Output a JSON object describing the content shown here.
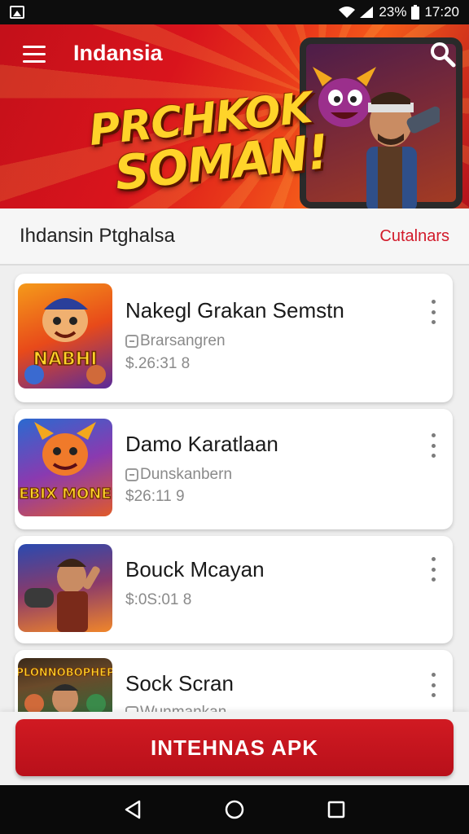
{
  "status_bar": {
    "battery_percent": "23%",
    "time": "17:20"
  },
  "header": {
    "title": "Indansia"
  },
  "banner": {
    "promo_line1": "PRCHKOK",
    "promo_line2": "SOMAN!"
  },
  "section": {
    "title": "Ihdansin Ptghalsa",
    "link": "Cutalnars"
  },
  "apps": [
    {
      "name": "Nakegl Grakan Semstn",
      "developer": "Brarsangren",
      "price": "$.26:31 8",
      "thumb_text": "NABHI"
    },
    {
      "name": "Damo Karatlaan",
      "developer": "Dunskanbern",
      "price": "$26:11 9",
      "thumb_text": "NEBIX MONEN"
    },
    {
      "name": "Bouck Mcayan",
      "developer": "",
      "price": "$:0S:01 8",
      "thumb_text": ""
    },
    {
      "name": "Sock Scran",
      "developer": "Wunmankan",
      "price": "",
      "thumb_text": "PLONNOBOPHEP"
    }
  ],
  "cta": {
    "label": "INTEHNAS APK"
  },
  "colors": {
    "accent": "#d21a2a",
    "banner_red": "#c3101a",
    "promo_yellow": "#ffd42a"
  },
  "icons": {
    "status": [
      "gallery-icon",
      "wifi-icon",
      "signal-icon",
      "battery-icon"
    ],
    "header": [
      "menu-icon",
      "search-icon"
    ],
    "nav": [
      "back-icon",
      "home-icon",
      "recents-icon"
    ]
  }
}
